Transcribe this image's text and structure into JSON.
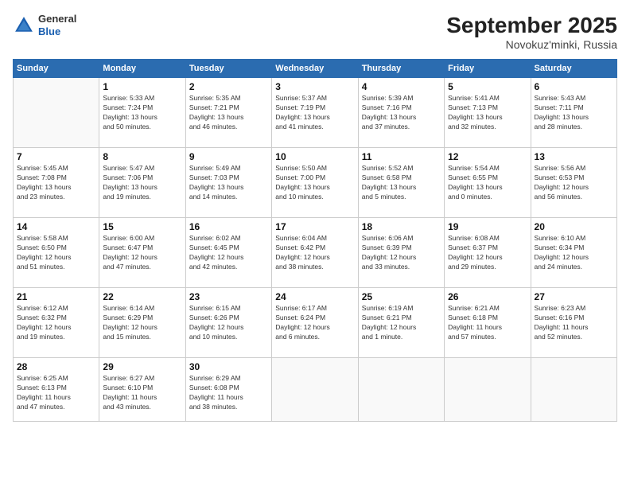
{
  "header": {
    "logo_general": "General",
    "logo_blue": "Blue",
    "month": "September 2025",
    "location": "Novokuz'minki, Russia"
  },
  "days_of_week": [
    "Sunday",
    "Monday",
    "Tuesday",
    "Wednesday",
    "Thursday",
    "Friday",
    "Saturday"
  ],
  "weeks": [
    [
      {
        "day": "",
        "content": ""
      },
      {
        "day": "1",
        "content": "Sunrise: 5:33 AM\nSunset: 7:24 PM\nDaylight: 13 hours\nand 50 minutes."
      },
      {
        "day": "2",
        "content": "Sunrise: 5:35 AM\nSunset: 7:21 PM\nDaylight: 13 hours\nand 46 minutes."
      },
      {
        "day": "3",
        "content": "Sunrise: 5:37 AM\nSunset: 7:19 PM\nDaylight: 13 hours\nand 41 minutes."
      },
      {
        "day": "4",
        "content": "Sunrise: 5:39 AM\nSunset: 7:16 PM\nDaylight: 13 hours\nand 37 minutes."
      },
      {
        "day": "5",
        "content": "Sunrise: 5:41 AM\nSunset: 7:13 PM\nDaylight: 13 hours\nand 32 minutes."
      },
      {
        "day": "6",
        "content": "Sunrise: 5:43 AM\nSunset: 7:11 PM\nDaylight: 13 hours\nand 28 minutes."
      }
    ],
    [
      {
        "day": "7",
        "content": "Sunrise: 5:45 AM\nSunset: 7:08 PM\nDaylight: 13 hours\nand 23 minutes."
      },
      {
        "day": "8",
        "content": "Sunrise: 5:47 AM\nSunset: 7:06 PM\nDaylight: 13 hours\nand 19 minutes."
      },
      {
        "day": "9",
        "content": "Sunrise: 5:49 AM\nSunset: 7:03 PM\nDaylight: 13 hours\nand 14 minutes."
      },
      {
        "day": "10",
        "content": "Sunrise: 5:50 AM\nSunset: 7:00 PM\nDaylight: 13 hours\nand 10 minutes."
      },
      {
        "day": "11",
        "content": "Sunrise: 5:52 AM\nSunset: 6:58 PM\nDaylight: 13 hours\nand 5 minutes."
      },
      {
        "day": "12",
        "content": "Sunrise: 5:54 AM\nSunset: 6:55 PM\nDaylight: 13 hours\nand 0 minutes."
      },
      {
        "day": "13",
        "content": "Sunrise: 5:56 AM\nSunset: 6:53 PM\nDaylight: 12 hours\nand 56 minutes."
      }
    ],
    [
      {
        "day": "14",
        "content": "Sunrise: 5:58 AM\nSunset: 6:50 PM\nDaylight: 12 hours\nand 51 minutes."
      },
      {
        "day": "15",
        "content": "Sunrise: 6:00 AM\nSunset: 6:47 PM\nDaylight: 12 hours\nand 47 minutes."
      },
      {
        "day": "16",
        "content": "Sunrise: 6:02 AM\nSunset: 6:45 PM\nDaylight: 12 hours\nand 42 minutes."
      },
      {
        "day": "17",
        "content": "Sunrise: 6:04 AM\nSunset: 6:42 PM\nDaylight: 12 hours\nand 38 minutes."
      },
      {
        "day": "18",
        "content": "Sunrise: 6:06 AM\nSunset: 6:39 PM\nDaylight: 12 hours\nand 33 minutes."
      },
      {
        "day": "19",
        "content": "Sunrise: 6:08 AM\nSunset: 6:37 PM\nDaylight: 12 hours\nand 29 minutes."
      },
      {
        "day": "20",
        "content": "Sunrise: 6:10 AM\nSunset: 6:34 PM\nDaylight: 12 hours\nand 24 minutes."
      }
    ],
    [
      {
        "day": "21",
        "content": "Sunrise: 6:12 AM\nSunset: 6:32 PM\nDaylight: 12 hours\nand 19 minutes."
      },
      {
        "day": "22",
        "content": "Sunrise: 6:14 AM\nSunset: 6:29 PM\nDaylight: 12 hours\nand 15 minutes."
      },
      {
        "day": "23",
        "content": "Sunrise: 6:15 AM\nSunset: 6:26 PM\nDaylight: 12 hours\nand 10 minutes."
      },
      {
        "day": "24",
        "content": "Sunrise: 6:17 AM\nSunset: 6:24 PM\nDaylight: 12 hours\nand 6 minutes."
      },
      {
        "day": "25",
        "content": "Sunrise: 6:19 AM\nSunset: 6:21 PM\nDaylight: 12 hours\nand 1 minute."
      },
      {
        "day": "26",
        "content": "Sunrise: 6:21 AM\nSunset: 6:18 PM\nDaylight: 11 hours\nand 57 minutes."
      },
      {
        "day": "27",
        "content": "Sunrise: 6:23 AM\nSunset: 6:16 PM\nDaylight: 11 hours\nand 52 minutes."
      }
    ],
    [
      {
        "day": "28",
        "content": "Sunrise: 6:25 AM\nSunset: 6:13 PM\nDaylight: 11 hours\nand 47 minutes."
      },
      {
        "day": "29",
        "content": "Sunrise: 6:27 AM\nSunset: 6:10 PM\nDaylight: 11 hours\nand 43 minutes."
      },
      {
        "day": "30",
        "content": "Sunrise: 6:29 AM\nSunset: 6:08 PM\nDaylight: 11 hours\nand 38 minutes."
      },
      {
        "day": "",
        "content": ""
      },
      {
        "day": "",
        "content": ""
      },
      {
        "day": "",
        "content": ""
      },
      {
        "day": "",
        "content": ""
      }
    ]
  ]
}
